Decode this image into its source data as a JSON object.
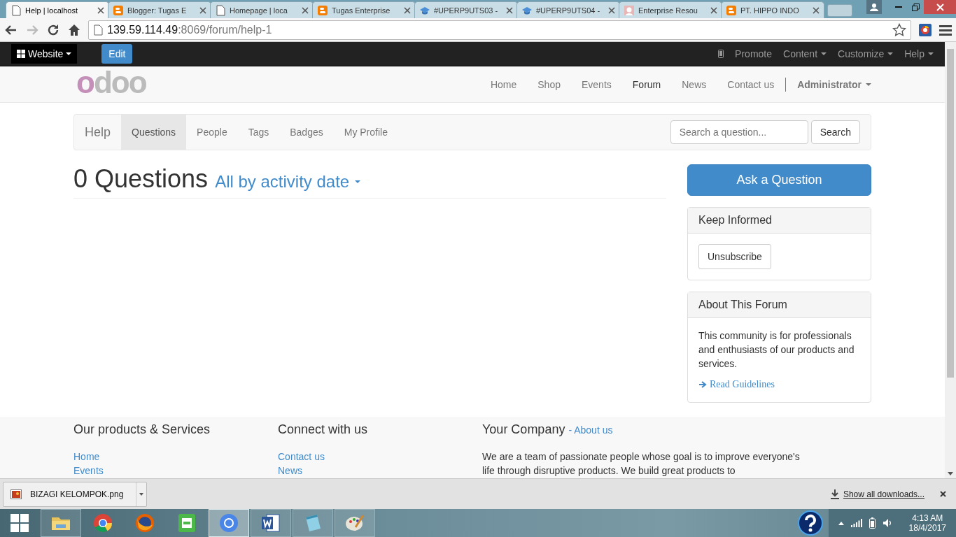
{
  "browser": {
    "tabs": [
      {
        "title": "Help | localhost",
        "kind": "page",
        "selected": true
      },
      {
        "title": "Blogger: Tugas E",
        "kind": "blogger",
        "selected": false
      },
      {
        "title": "Homepage | loca",
        "kind": "page",
        "selected": false
      },
      {
        "title": "Tugas Enterprise",
        "kind": "blogger",
        "selected": false
      },
      {
        "title": "#UPERP9UTS03 -",
        "kind": "cap",
        "selected": false
      },
      {
        "title": "#UPERP9UTS04 -",
        "kind": "cap",
        "selected": false
      },
      {
        "title": "Enterprise Resou",
        "kind": "avatar",
        "selected": false
      },
      {
        "title": "PT. HIPPO INDO",
        "kind": "blogger",
        "selected": false
      }
    ],
    "address": {
      "host": "139.59.114.49",
      "path": ":8069/forum/help-1"
    }
  },
  "admin_bar": {
    "website_menu": "Website",
    "edit_button": "Edit",
    "right_items": [
      {
        "label": "Promote",
        "dropdown": false
      },
      {
        "label": "Content",
        "dropdown": true
      },
      {
        "label": "Customize",
        "dropdown": true
      },
      {
        "label": "Help",
        "dropdown": true
      }
    ]
  },
  "header": {
    "logo": "odoo",
    "menu": [
      {
        "label": "Home",
        "selected": false
      },
      {
        "label": "Shop",
        "selected": false
      },
      {
        "label": "Events",
        "selected": false
      },
      {
        "label": "Forum",
        "selected": true
      },
      {
        "label": "News",
        "selected": false
      },
      {
        "label": "Contact us",
        "selected": false
      }
    ],
    "user": "Administrator"
  },
  "forum_nav": {
    "brand": "Help",
    "items": [
      {
        "label": "Questions",
        "selected": true
      },
      {
        "label": "People",
        "selected": false
      },
      {
        "label": "Tags",
        "selected": false
      },
      {
        "label": "Badges",
        "selected": false
      },
      {
        "label": "My Profile",
        "selected": false
      }
    ],
    "search": {
      "placeholder": "Search a question...",
      "button": "Search"
    }
  },
  "questions": {
    "count_title": "0 Questions",
    "sort": "All by activity date"
  },
  "sidebar": {
    "ask_button": "Ask a Question",
    "keep_informed": {
      "title": "Keep Informed",
      "button": "Unsubscribe"
    },
    "about": {
      "title": "About This Forum",
      "text": "This community is for professionals and enthusiasts of our products and services.",
      "link": "Read Guidelines"
    }
  },
  "footer": {
    "columns": [
      {
        "title": "Our products & Services",
        "links": [
          "Home",
          "Events"
        ]
      },
      {
        "title": "Connect with us",
        "links": [
          "Contact us",
          "News"
        ]
      }
    ],
    "company": {
      "title": "Your Company",
      "link": "- About us",
      "text": "We are a team of passionate people whose goal is to improve everyone's life through disruptive products. We build great products to"
    }
  },
  "downloads": {
    "file": "BIZAGI KELOMPOK.png",
    "show_all": "Show all downloads..."
  },
  "taskbar": {
    "apps": [
      {
        "kind": "explorer",
        "running": true,
        "selected": false
      },
      {
        "kind": "chrome",
        "running": false,
        "selected": false
      },
      {
        "kind": "firefox",
        "running": false,
        "selected": false
      },
      {
        "kind": "mp3",
        "running": false,
        "selected": false
      },
      {
        "kind": "chromium",
        "running": true,
        "selected": true
      },
      {
        "kind": "word",
        "running": true,
        "selected": false
      },
      {
        "kind": "notepad",
        "running": true,
        "selected": false
      },
      {
        "kind": "paint",
        "running": true,
        "selected": false
      }
    ],
    "time": "4:13 AM",
    "date": "18/4/2017"
  }
}
